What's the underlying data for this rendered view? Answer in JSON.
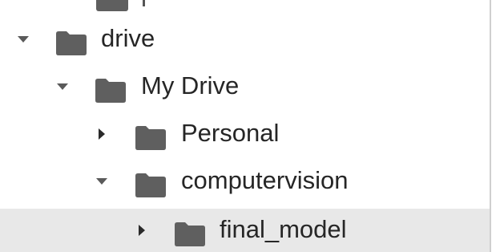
{
  "tree": {
    "items": [
      {
        "label": "drive",
        "expanded": true,
        "icon": "folder-icon"
      },
      {
        "label": "My Drive",
        "expanded": true,
        "icon": "folder-icon"
      },
      {
        "label": "Personal",
        "expanded": false,
        "icon": "folder-icon"
      },
      {
        "label": "computervision",
        "expanded": true,
        "icon": "folder-icon"
      },
      {
        "label": "final_model",
        "expanded": false,
        "selected": true,
        "icon": "folder-icon"
      }
    ]
  },
  "colors": {
    "folder": "#5f5f5f",
    "selected_row": "#e8e8e8",
    "text": "#262626"
  }
}
